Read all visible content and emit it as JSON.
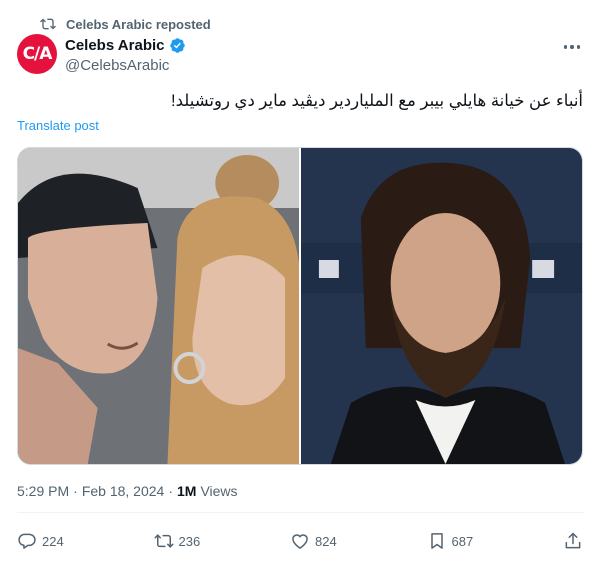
{
  "repost": {
    "icon": "repost-icon",
    "text": "Celebs Arabic reposted"
  },
  "author": {
    "avatar_text": "C/A",
    "name": "Celebs Arabic",
    "handle": "@CelebsArabic",
    "verified": true,
    "avatar_color": "#e5123d"
  },
  "tweet": {
    "text": "أنباء عن خيانة هايلي بيبر مع الملياردير ديڤيد ماير دي روتشيلد!",
    "translate_label": "Translate post"
  },
  "meta": {
    "time": "5:29 PM",
    "separator": "·",
    "date": "Feb 18, 2024",
    "views_count": "1M",
    "views_label": "Views"
  },
  "actions": {
    "replies": "224",
    "reposts": "236",
    "likes": "824",
    "bookmarks": "687"
  },
  "colors": {
    "accent": "#1d9bf0",
    "muted": "#536471",
    "text": "#0f1419"
  }
}
